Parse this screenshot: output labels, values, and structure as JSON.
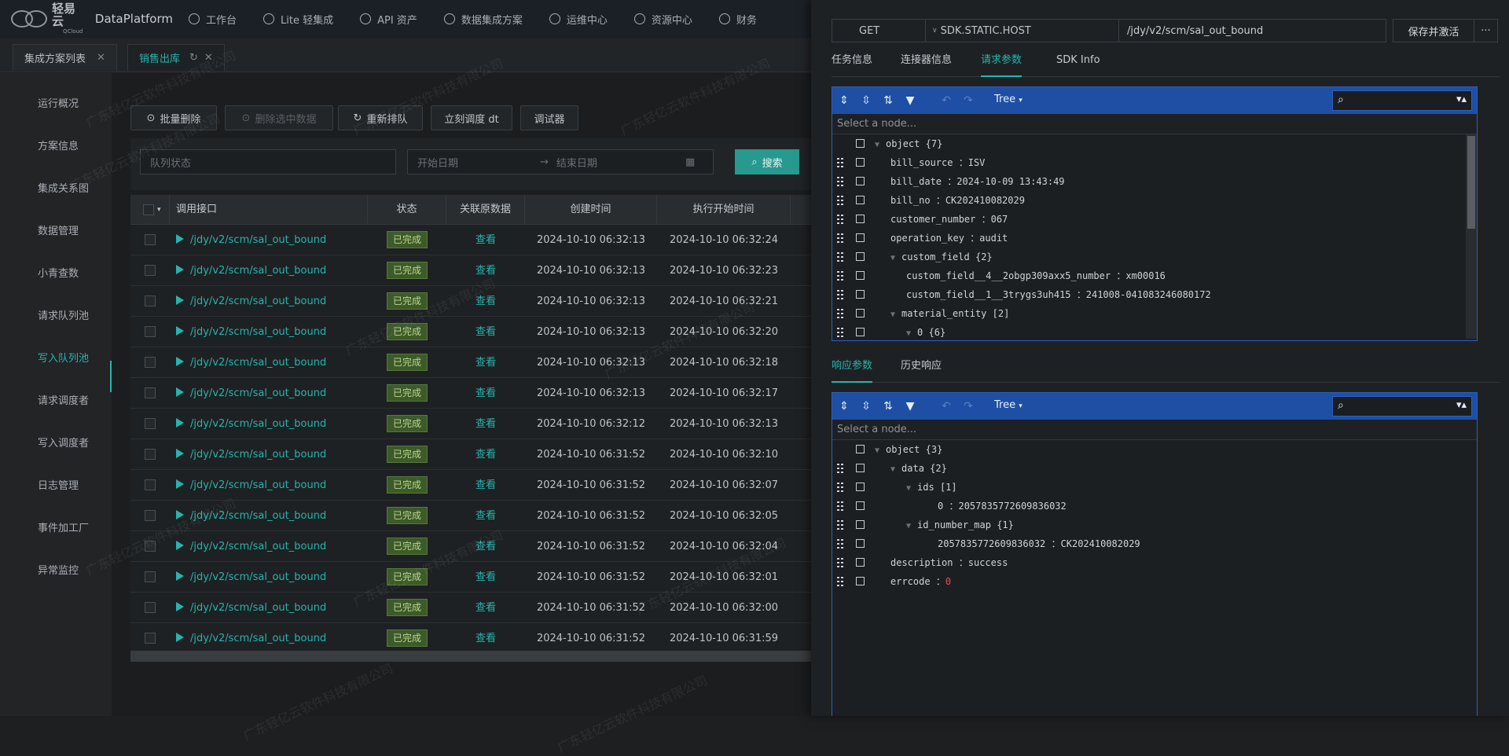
{
  "brand": {
    "logo_text": "轻易云",
    "logo_sub": "QCloud",
    "platform": "DataPlatform"
  },
  "nav": [
    "工作台",
    "Lite 轻集成",
    "API 资产",
    "数据集成方案",
    "运维中心",
    "资源中心",
    "财务"
  ],
  "tabs": [
    {
      "label": "集成方案列表"
    },
    {
      "label": "销售出库"
    }
  ],
  "sidebar": [
    "运行概况",
    "方案信息",
    "集成关系图",
    "数据管理",
    "小青查数",
    "请求队列池",
    "写入队列池",
    "请求调度者",
    "写入调度者",
    "日志管理",
    "事件加工厂",
    "异常监控"
  ],
  "toolbar": {
    "batch_delete": "批量删除",
    "delete_selected": "删除选中数据",
    "requeue": "重新排队",
    "dispatch": "立刻调度 dt",
    "debugger": "调试器"
  },
  "filters": {
    "queue_status": "队列状态",
    "start_date": "开始日期",
    "end_date": "结束日期",
    "search": "搜索"
  },
  "table": {
    "headers": [
      "调用接口",
      "状态",
      "关联原数据",
      "创建时间",
      "执行开始时间"
    ],
    "rows": [
      {
        "api": "/jdy/v2/scm/sal_out_bound",
        "status": "已完成",
        "link": "查看",
        "created": "2024-10-10 06:32:13",
        "started": "2024-10-10 06:32:24"
      },
      {
        "api": "/jdy/v2/scm/sal_out_bound",
        "status": "已完成",
        "link": "查看",
        "created": "2024-10-10 06:32:13",
        "started": "2024-10-10 06:32:23"
      },
      {
        "api": "/jdy/v2/scm/sal_out_bound",
        "status": "已完成",
        "link": "查看",
        "created": "2024-10-10 06:32:13",
        "started": "2024-10-10 06:32:21"
      },
      {
        "api": "/jdy/v2/scm/sal_out_bound",
        "status": "已完成",
        "link": "查看",
        "created": "2024-10-10 06:32:13",
        "started": "2024-10-10 06:32:20"
      },
      {
        "api": "/jdy/v2/scm/sal_out_bound",
        "status": "已完成",
        "link": "查看",
        "created": "2024-10-10 06:32:13",
        "started": "2024-10-10 06:32:18"
      },
      {
        "api": "/jdy/v2/scm/sal_out_bound",
        "status": "已完成",
        "link": "查看",
        "created": "2024-10-10 06:32:13",
        "started": "2024-10-10 06:32:17"
      },
      {
        "api": "/jdy/v2/scm/sal_out_bound",
        "status": "已完成",
        "link": "查看",
        "created": "2024-10-10 06:32:12",
        "started": "2024-10-10 06:32:13"
      },
      {
        "api": "/jdy/v2/scm/sal_out_bound",
        "status": "已完成",
        "link": "查看",
        "created": "2024-10-10 06:31:52",
        "started": "2024-10-10 06:32:10"
      },
      {
        "api": "/jdy/v2/scm/sal_out_bound",
        "status": "已完成",
        "link": "查看",
        "created": "2024-10-10 06:31:52",
        "started": "2024-10-10 06:32:07"
      },
      {
        "api": "/jdy/v2/scm/sal_out_bound",
        "status": "已完成",
        "link": "查看",
        "created": "2024-10-10 06:31:52",
        "started": "2024-10-10 06:32:05"
      },
      {
        "api": "/jdy/v2/scm/sal_out_bound",
        "status": "已完成",
        "link": "查看",
        "created": "2024-10-10 06:31:52",
        "started": "2024-10-10 06:32:04"
      },
      {
        "api": "/jdy/v2/scm/sal_out_bound",
        "status": "已完成",
        "link": "查看",
        "created": "2024-10-10 06:31:52",
        "started": "2024-10-10 06:32:01"
      },
      {
        "api": "/jdy/v2/scm/sal_out_bound",
        "status": "已完成",
        "link": "查看",
        "created": "2024-10-10 06:31:52",
        "started": "2024-10-10 06:32:00"
      },
      {
        "api": "/jdy/v2/scm/sal_out_bound",
        "status": "已完成",
        "link": "查看",
        "created": "2024-10-10 06:31:52",
        "started": "2024-10-10 06:31:59"
      }
    ]
  },
  "watermark": "广东轻亿云软件科技有限公司",
  "panel": {
    "method": "GET",
    "host": "SDK.STATIC.HOST",
    "path": "/jdy/v2/scm/sal_out_bound",
    "save": "保存并激活",
    "more": "···",
    "tabs": [
      "任务信息",
      "连接器信息",
      "请求参数",
      "SDK Info"
    ],
    "resp_tabs": [
      "响应参数",
      "历史响应"
    ],
    "tree_label": "Tree",
    "select_node": "Select a node...",
    "request_tree": [
      {
        "key": "object",
        "count": "{7}",
        "arrow": true
      },
      {
        "key": "bill_source",
        "value": "ISV"
      },
      {
        "key": "bill_date",
        "value": "2024-10-09 13:43:49"
      },
      {
        "key": "bill_no",
        "value": "CK202410082029"
      },
      {
        "key": "customer_number",
        "value": "067"
      },
      {
        "key": "operation_key",
        "value": "audit"
      },
      {
        "key": "custom_field",
        "count": "{2}",
        "arrow": true
      },
      {
        "key": "custom_field__4__2obgp309axx5_number",
        "value": "xm00016"
      },
      {
        "key": "custom_field__1__3trygs3uh415",
        "value": "241008-041083246080172"
      },
      {
        "key": "material_entity",
        "count": "[2]",
        "arrow": true
      },
      {
        "key": "0",
        "count": "{6}",
        "arrow": true
      }
    ],
    "response_tree": [
      {
        "key": "object",
        "count": "{3}",
        "arrow": true
      },
      {
        "key": "data",
        "count": "{2}",
        "arrow": true
      },
      {
        "key": "ids",
        "count": "[1]",
        "arrow": true
      },
      {
        "key": "0",
        "value": "2057835772609836032"
      },
      {
        "key": "id_number_map",
        "count": "{1}",
        "arrow": true
      },
      {
        "key": "2057835772609836032",
        "value": "CK202410082029"
      },
      {
        "key": "description",
        "value": "success"
      },
      {
        "key": "errcode",
        "value": "0",
        "numeric": true
      }
    ]
  }
}
